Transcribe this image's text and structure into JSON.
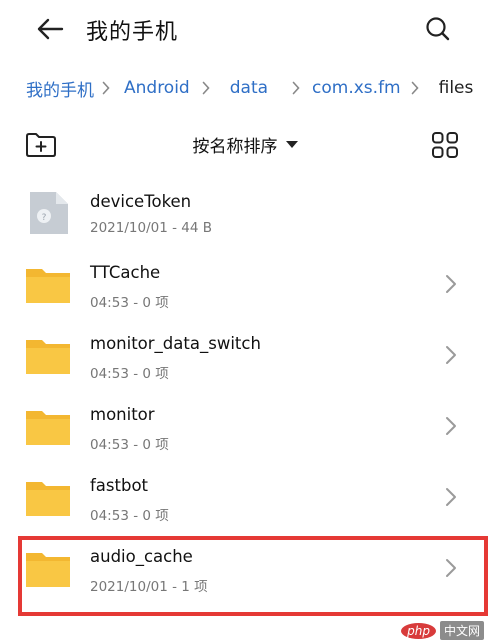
{
  "header": {
    "title": "我的手机",
    "back_icon": "arrow-left-icon",
    "search_icon": "search-icon"
  },
  "breadcrumb": {
    "items": [
      {
        "label": "我的手机"
      },
      {
        "label": "Android"
      },
      {
        "label": "data"
      },
      {
        "label": "com.xs.fm"
      },
      {
        "label": "files"
      }
    ]
  },
  "toolbar": {
    "sort_label": "按名称排序",
    "new_folder_icon": "new-folder-icon",
    "grid_view_icon": "grid-view-icon"
  },
  "files": [
    {
      "name": "deviceToken",
      "meta": "2021/10/01 - 44 B",
      "type": "file"
    },
    {
      "name": "TTCache",
      "meta": "04:53 - 0 项",
      "type": "folder"
    },
    {
      "name": "monitor_data_switch",
      "meta": "04:53 - 0 项",
      "type": "folder"
    },
    {
      "name": "monitor",
      "meta": "04:53 - 0 项",
      "type": "folder"
    },
    {
      "name": "fastbot",
      "meta": "04:53 - 0 项",
      "type": "folder"
    },
    {
      "name": "audio_cache",
      "meta": "2021/10/01 - 1 项",
      "type": "folder"
    }
  ],
  "watermark": {
    "logo": "php",
    "text": "中文网"
  },
  "colors": {
    "accent": "#2f6fc6",
    "folder": "#f7c33f",
    "highlight": "#e53935"
  }
}
